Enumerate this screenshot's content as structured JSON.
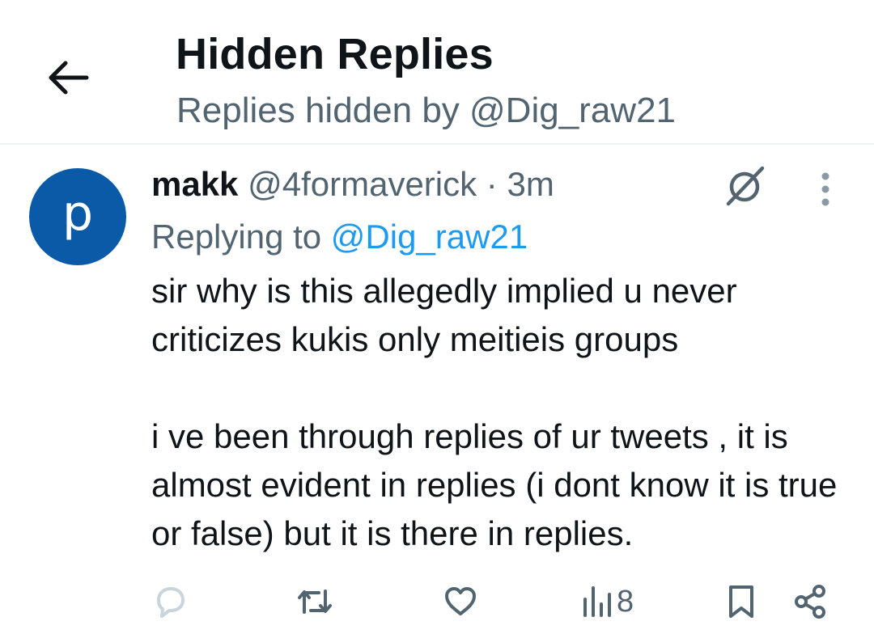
{
  "header": {
    "back_icon": "arrow-left-icon",
    "title": "Hidden Replies",
    "subtitle": "Replies hidden by @Dig_raw21"
  },
  "tweet": {
    "avatar_letter": "p",
    "avatar_color": "#0a5aa8",
    "author_name": "makk",
    "author_handle": "@4formaverick",
    "separator": "·",
    "time": "3m",
    "replying_prefix": "Replying to",
    "replying_to": "@Dig_raw21",
    "text": "sir why is this allegedly implied u never criticizes kukis only meitieis groups\n\ni ve been through replies of ur tweets , it is almost evident in replies (i dont know it is true or false) but it is there in replies.",
    "unhide_icon": "hidden-reply-icon",
    "more_icon": "more-vertical-icon"
  },
  "actions": {
    "reply_icon": "reply-icon",
    "retweet_icon": "retweet-icon",
    "like_icon": "heart-icon",
    "views_icon": "views-icon",
    "views_count": "8",
    "bookmark_icon": "bookmark-icon",
    "share_icon": "share-icon"
  },
  "colors": {
    "accent": "#1d9bf0",
    "secondary_text": "#536471",
    "reply_icon_disabled": "#c9d4dc",
    "icon": "#536471"
  }
}
